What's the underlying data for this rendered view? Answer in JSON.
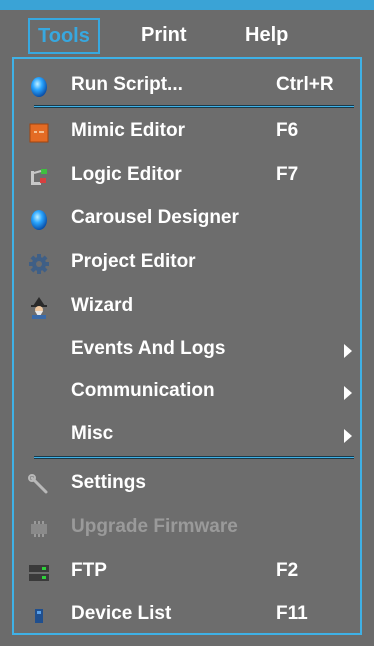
{
  "menubar": {
    "items": [
      {
        "label": "Tools"
      },
      {
        "label": "Print"
      },
      {
        "label": "Help"
      }
    ]
  },
  "menu": {
    "items": [
      {
        "label": "Run Script...",
        "shortcut": "Ctrl+R"
      },
      {
        "label": "Mimic Editor",
        "shortcut": "F6"
      },
      {
        "label": "Logic Editor",
        "shortcut": "F7"
      },
      {
        "label": "Carousel Designer"
      },
      {
        "label": "Project Editor"
      },
      {
        "label": "Wizard"
      },
      {
        "label": "Events And Logs"
      },
      {
        "label": "Communication"
      },
      {
        "label": "Misc"
      },
      {
        "label": "Settings"
      },
      {
        "label": "Upgrade Firmware"
      },
      {
        "label": "FTP",
        "shortcut": "F2"
      },
      {
        "label": "Device List",
        "shortcut": "F11"
      }
    ]
  },
  "colors": {
    "accent": "#3fb1e6",
    "top_strip": "#3aa3d6",
    "background": "#6b6b6b",
    "disabled_text": "#9a9a9a"
  }
}
